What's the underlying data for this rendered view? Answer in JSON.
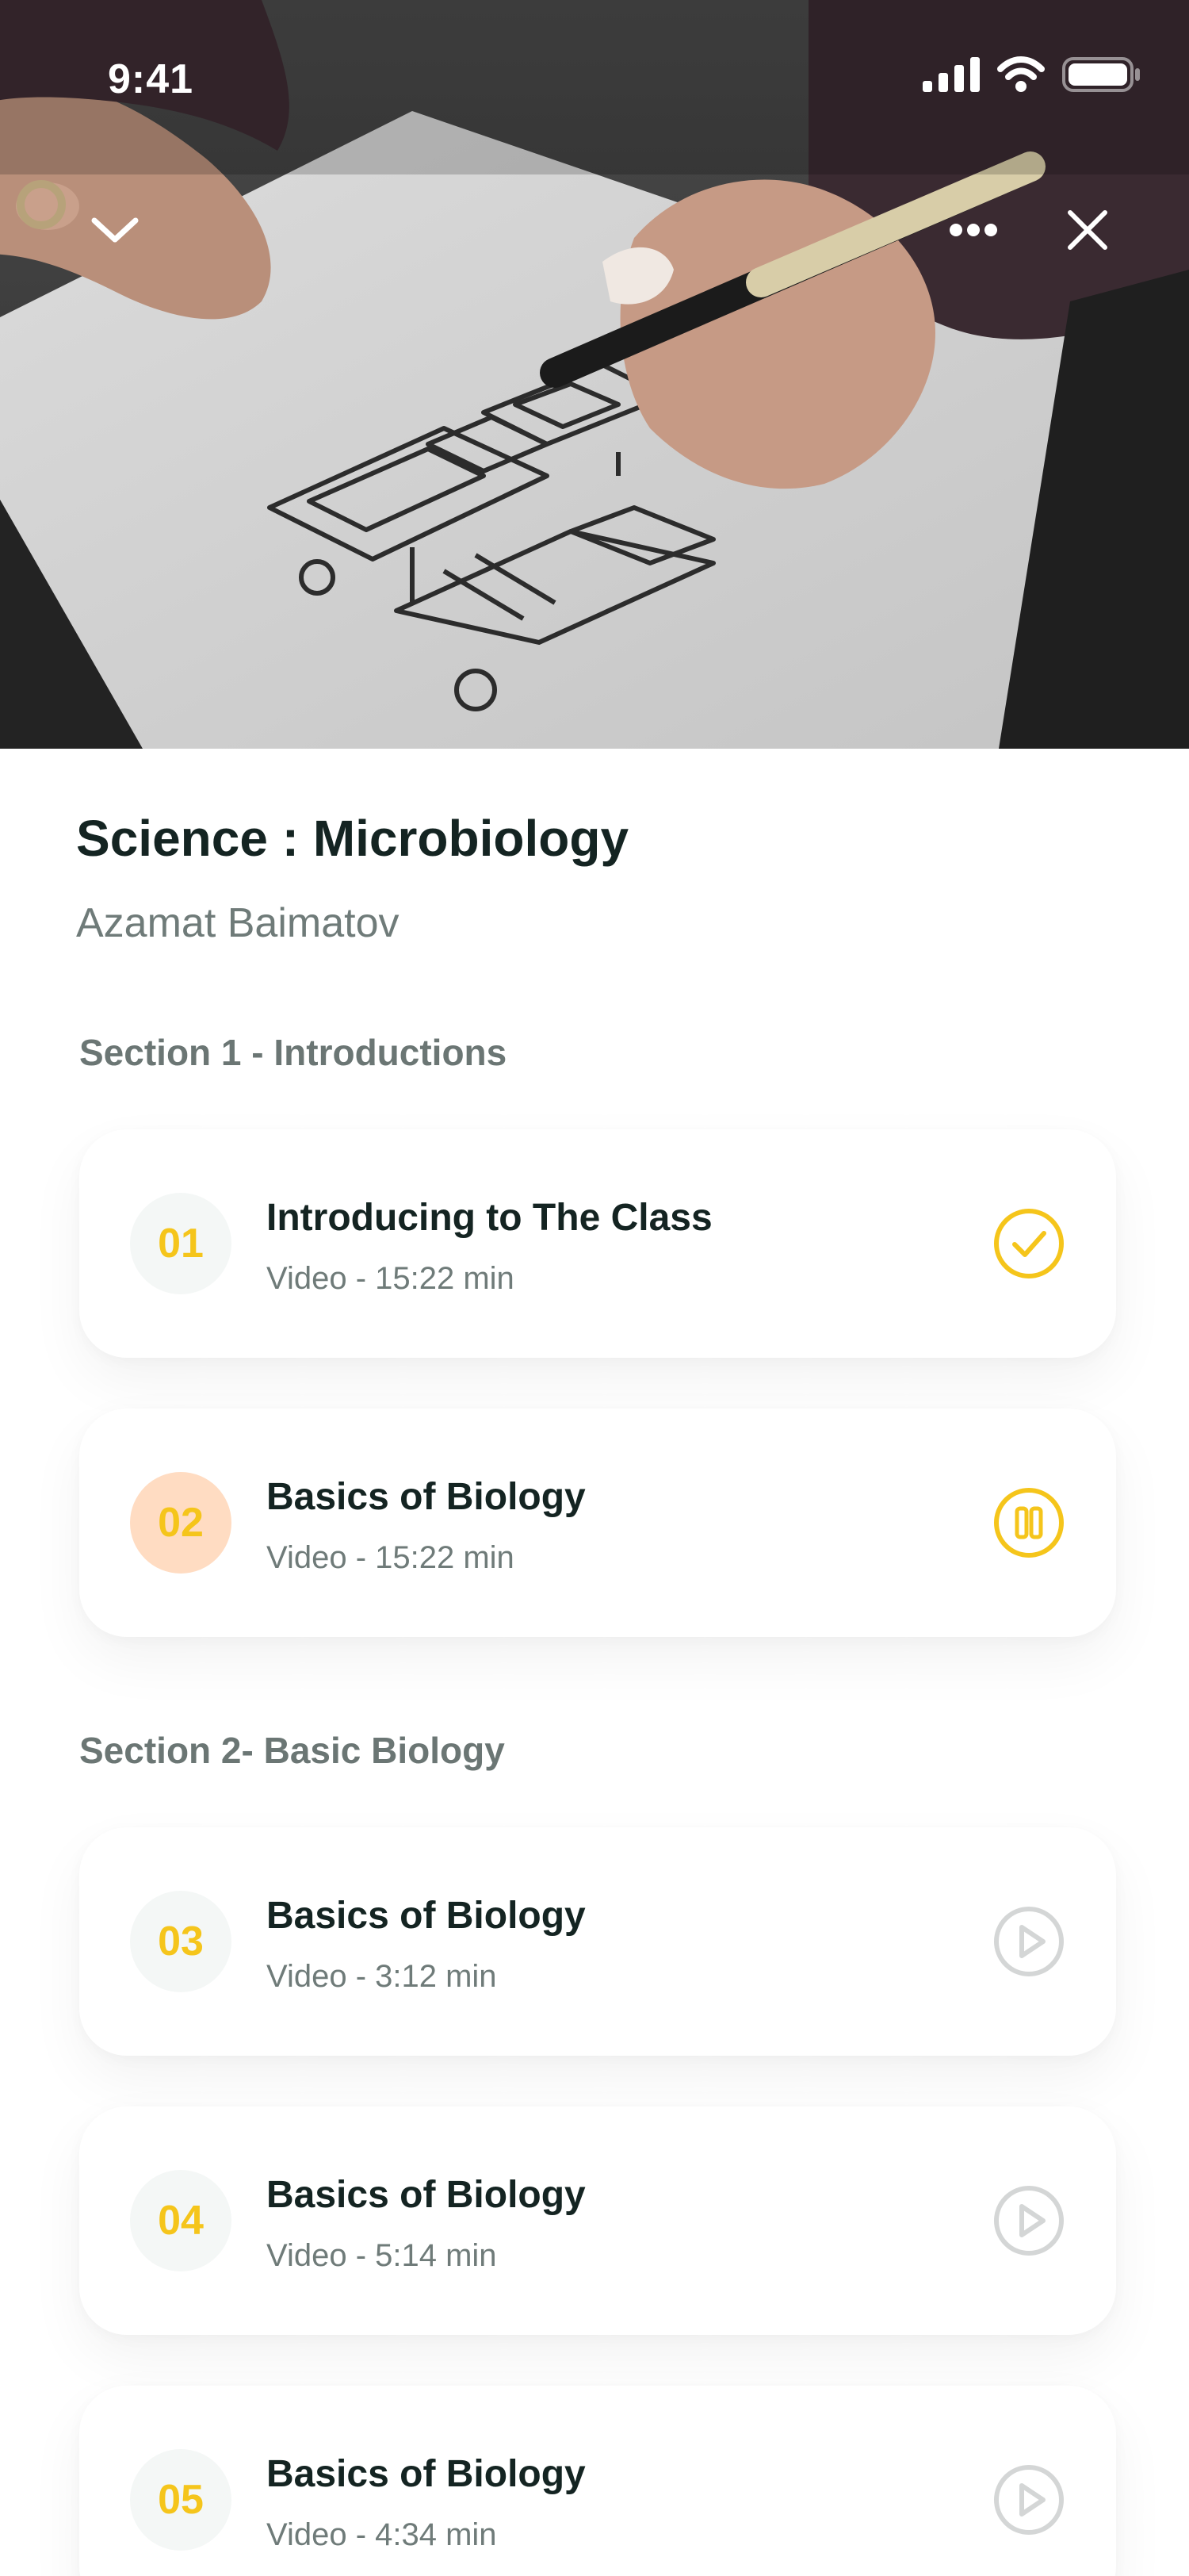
{
  "status_bar": {
    "time": "9:41"
  },
  "course": {
    "title": "Science : Microbiology",
    "author": "Azamat Baimatov"
  },
  "sections": [
    {
      "title": "Section 1 - Introductions",
      "lessons": [
        {
          "number": "01",
          "title": "Introducing to The Class",
          "meta": "Video - 15:22 min",
          "status_icon": "check-circle-icon"
        },
        {
          "number": "02",
          "title": "Basics of Biology",
          "meta": "Video - 15:22 min",
          "status_icon": "pause-circle-icon"
        }
      ]
    },
    {
      "title": "Section 2- Basic Biology",
      "lessons": [
        {
          "number": "03",
          "title": "Basics of Biology",
          "meta": "Video - 3:12 min",
          "status_icon": "play-circle-icon"
        },
        {
          "number": "04",
          "title": "Basics of Biology",
          "meta": "Video - 5:14 min",
          "status_icon": "play-circle-icon"
        },
        {
          "number": "05",
          "title": "Basics of Biology",
          "meta": "Video - 4:34 min",
          "status_icon": "play-circle-icon"
        }
      ]
    }
  ],
  "colors": {
    "accent": "#F5C51B",
    "active_badge_bg": "#FFDCC2",
    "inactive_icon": "#D4D6D6",
    "heading": "#142422",
    "muted": "#6F7B79"
  }
}
